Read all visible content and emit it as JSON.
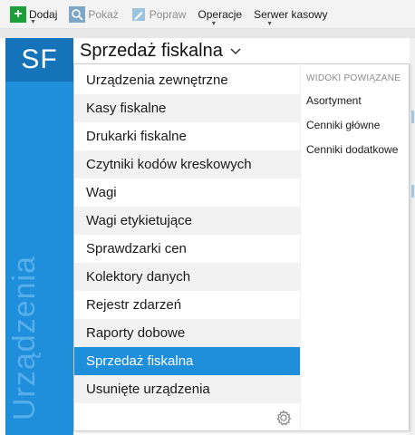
{
  "toolbar": {
    "add_label": "Dodaj",
    "show_label": "Pokaż",
    "edit_label": "Popraw",
    "operations_label": "Operacje",
    "cash_server_label": "Serwer kasowy"
  },
  "module": {
    "abbr": "SF",
    "vertical_label": "Urządzenia",
    "title": "Sprzedaż fiskalna",
    "accent": "#1f8fdc",
    "abbr_bg": "#1473b9"
  },
  "menu": {
    "items": [
      {
        "label": "Urządzenia zewnętrzne"
      },
      {
        "label": "Kasy fiskalne"
      },
      {
        "label": "Drukarki fiskalne"
      },
      {
        "label": "Czytniki kodów kreskowych"
      },
      {
        "label": "Wagi"
      },
      {
        "label": "Wagi etykietujące"
      },
      {
        "label": "Sprawdzarki cen"
      },
      {
        "label": "Kolektory danych"
      },
      {
        "label": "Rejestr zdarzeń"
      },
      {
        "label": "Raporty dobowe"
      },
      {
        "label": "Sprzedaż fiskalna"
      },
      {
        "label": "Usunięte urządzenia"
      }
    ],
    "active_index": 10
  },
  "related": {
    "header": "WIDOKI POWIĄZANE",
    "links": [
      "Asortyment",
      "Cenniki główne",
      "Cenniki dodatkowe"
    ]
  }
}
